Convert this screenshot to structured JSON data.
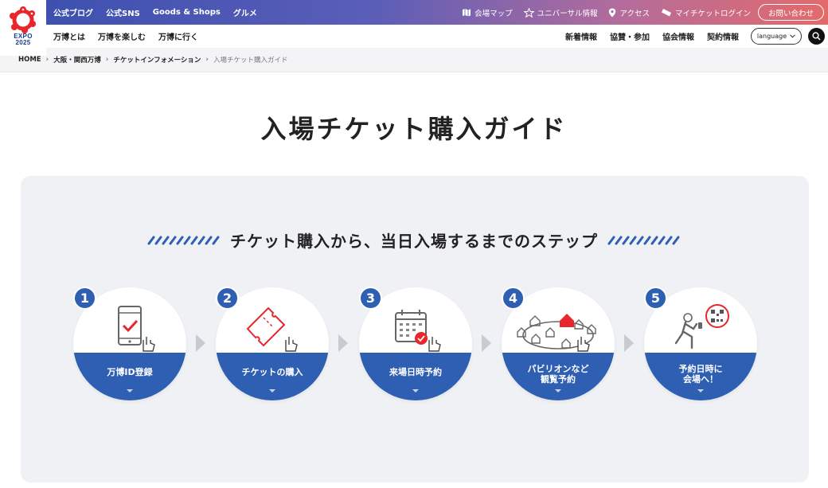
{
  "logo": {
    "text_line1": "EXPO",
    "text_line2": "2025",
    "colors": {
      "ring": "#e8262b",
      "text": "#1a3d93"
    }
  },
  "topbar": {
    "left_links": [
      "公式ブログ",
      "公式SNS",
      "Goods & Shops",
      "グルメ"
    ],
    "right_links": [
      {
        "icon": "map-icon",
        "label": "会場マップ"
      },
      {
        "icon": "universal-icon",
        "label": "ユニバーサル情報"
      },
      {
        "icon": "location-pin-icon",
        "label": "アクセス"
      },
      {
        "icon": "ticket-icon",
        "label": "マイチケットログイン"
      }
    ],
    "contact_label": "お問い合わせ"
  },
  "nav2": {
    "left": [
      "万博とは",
      "万博を楽しむ",
      "万博に行く"
    ],
    "right": [
      "新着情報",
      "協賛・参加",
      "協会情報",
      "契約情報"
    ],
    "language_label": "language"
  },
  "breadcrumb": [
    "HOME",
    "大阪・関西万博",
    "チケットインフォメーション",
    "入場チケット購入ガイド"
  ],
  "page_title": "入場チケット購入ガイド",
  "steps_heading": "チケット購入から、当日入場するまでのステップ",
  "steps": [
    {
      "number": "1",
      "label_lines": [
        "万博ID登録"
      ],
      "icon": "smartphone-check-icon"
    },
    {
      "number": "2",
      "label_lines": [
        "チケットの購入"
      ],
      "icon": "ticket-icon"
    },
    {
      "number": "3",
      "label_lines": [
        "来場日時予約"
      ],
      "icon": "calendar-check-icon"
    },
    {
      "number": "4",
      "label_lines": [
        "パビリオンなど",
        "観覧予約"
      ],
      "icon": "pavilion-map-icon"
    },
    {
      "number": "5",
      "label_lines": [
        "予約日時に",
        "会場へ！"
      ],
      "icon": "walking-qr-icon"
    }
  ],
  "colors": {
    "accent_blue": "#2f5fb3",
    "accent_red": "#e8262b",
    "panel_bg": "#eff1f4"
  }
}
